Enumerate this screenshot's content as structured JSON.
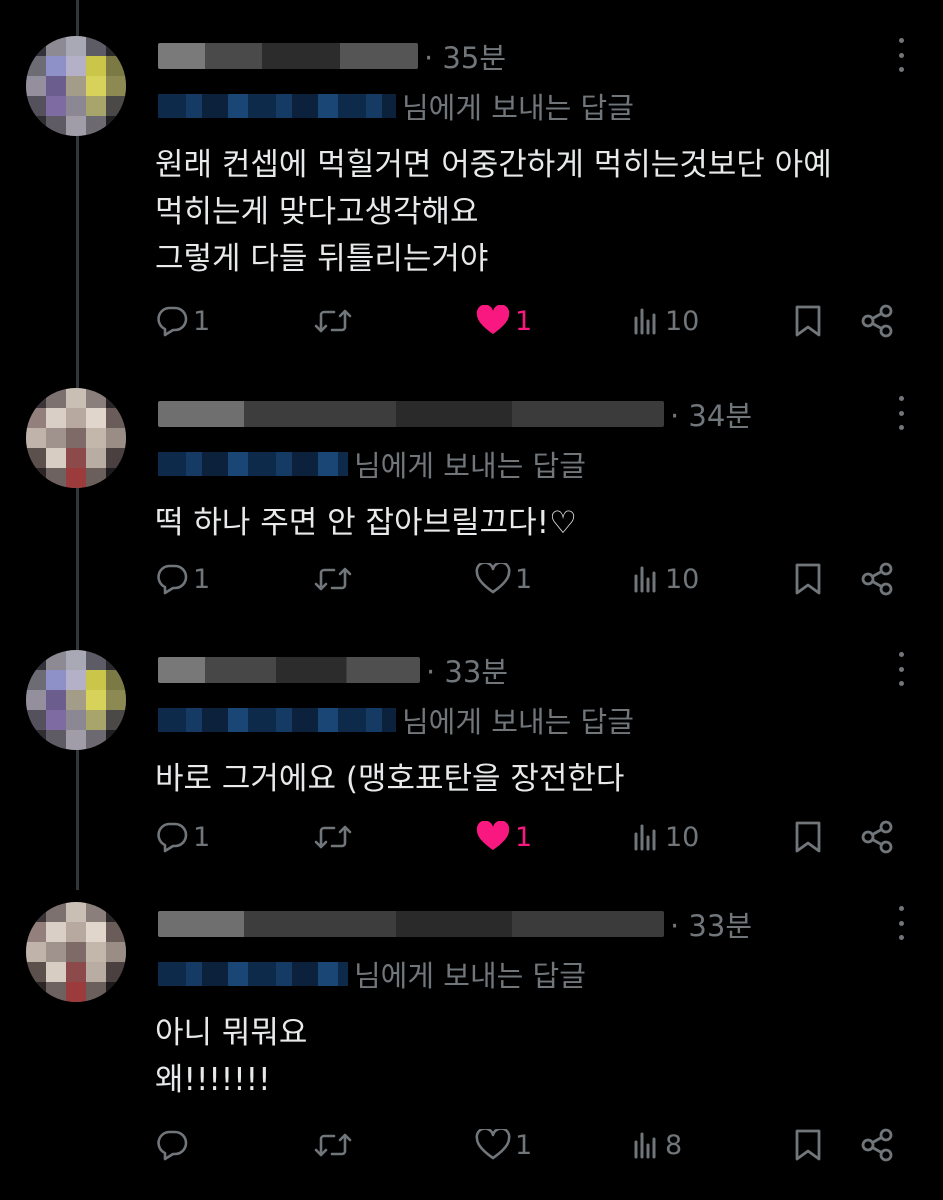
{
  "replies": [
    {
      "time": "· 35분",
      "reply_to": "님에게 보내는 답글",
      "lines": [
        "원래 컨셉에 먹힐거면 어중간하게 먹히는것보단 아예",
        "먹히는게 맞다고생각해요",
        "그렇게 다들 뒤틀리는거야"
      ],
      "reply_count": "1",
      "retweet_count": "",
      "like_count": "1",
      "liked": true,
      "view_count": "10"
    },
    {
      "time": "· 34분",
      "reply_to": "님에게 보내는 답글",
      "lines": [
        "떡 하나 주면 안 잡아브릴끄다!♡"
      ],
      "reply_count": "1",
      "retweet_count": "",
      "like_count": "1",
      "liked": false,
      "view_count": "10"
    },
    {
      "time": "· 33분",
      "reply_to": "님에게 보내는 답글",
      "lines": [
        "바로 그거에요 (맹호표탄을 장전한다"
      ],
      "reply_count": "1",
      "retweet_count": "",
      "like_count": "1",
      "liked": true,
      "view_count": "10"
    },
    {
      "time": "· 33분",
      "reply_to": "님에게 보내는 답글",
      "lines": [
        "아니 뭐뭐요",
        "왜!!!!!!!"
      ],
      "reply_count": "",
      "retweet_count": "",
      "like_count": "1",
      "liked": false,
      "view_count": "8"
    }
  ],
  "icons": {
    "reply": "comment-bubble-icon",
    "retweet": "retweet-icon",
    "like": "heart-icon",
    "views": "bar-chart-icon",
    "bookmark": "bookmark-icon",
    "share": "share-icon",
    "more": "more-vertical-icon"
  },
  "colors": {
    "background": "#000000",
    "text": "#e7e9ea",
    "muted": "#71767b",
    "like_active": "#f91880"
  }
}
